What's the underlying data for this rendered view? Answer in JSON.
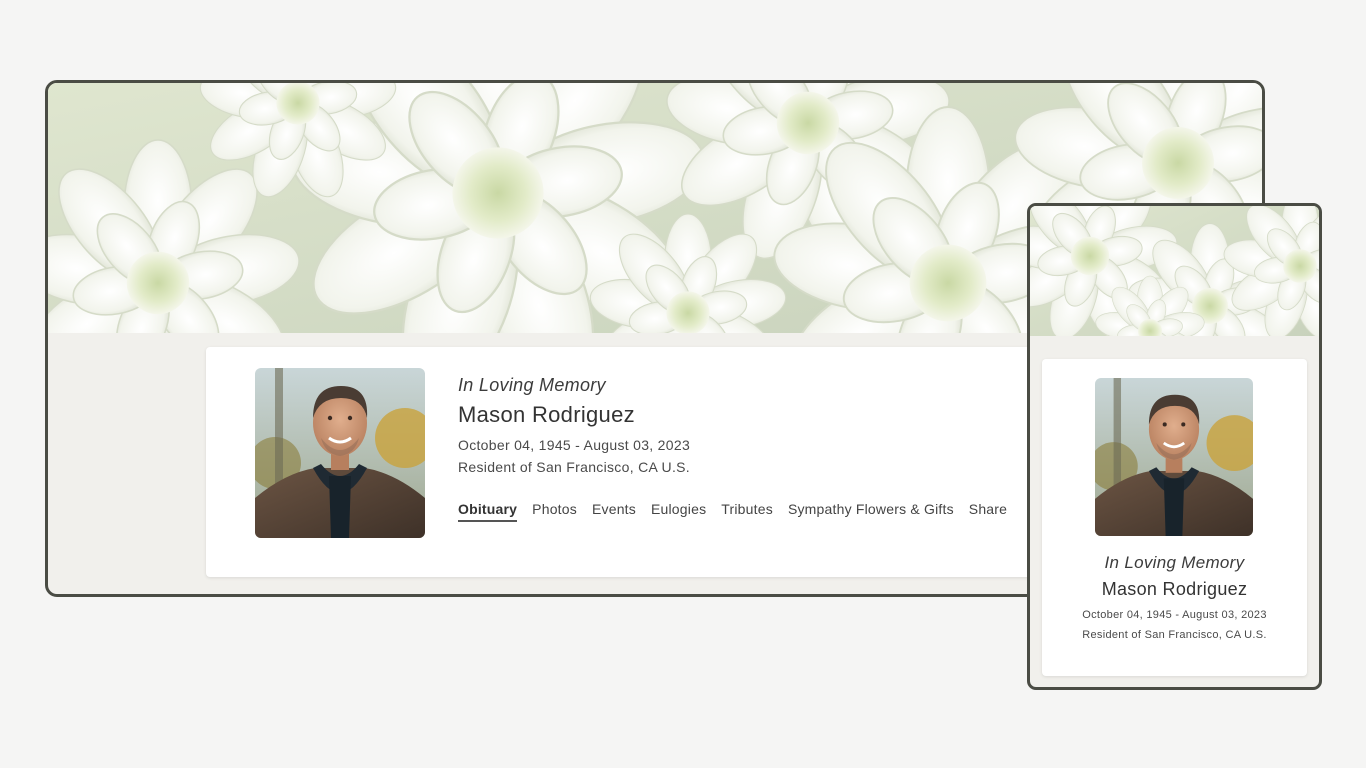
{
  "memorial": {
    "tagline": "In Loving Memory",
    "name": "Mason Rodriguez",
    "dates": "October 04, 1945 - August 03, 2023",
    "residence": "Resident of San Francisco, CA U.S."
  },
  "nav": {
    "tabs": [
      {
        "label": "Obituary",
        "active": true
      },
      {
        "label": "Photos",
        "active": false
      },
      {
        "label": "Events",
        "active": false
      },
      {
        "label": "Eulogies",
        "active": false
      },
      {
        "label": "Tributes",
        "active": false
      },
      {
        "label": "Sympathy Flowers & Gifts",
        "active": false
      },
      {
        "label": "Share",
        "active": false
      }
    ]
  },
  "colors": {
    "page_background": "#f5f5f4",
    "frame_border": "#4a4c44",
    "content_background": "#f1f0ec",
    "card_background": "#ffffff",
    "text": "#333333"
  }
}
